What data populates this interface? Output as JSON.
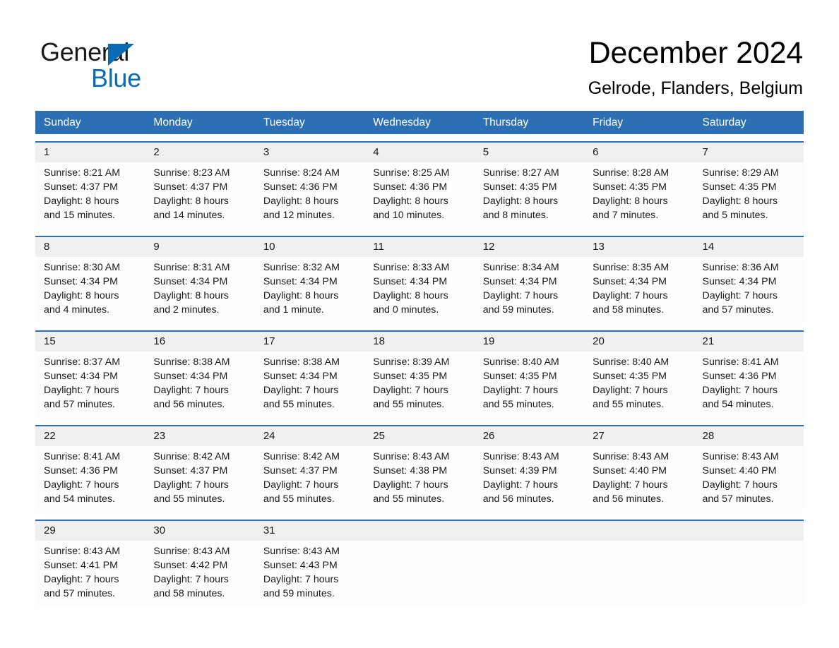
{
  "brand": {
    "name_part1": "General",
    "name_part2": "Blue",
    "logo_icon": "triangle-icon",
    "accent_color": "#0a6bb5"
  },
  "header": {
    "title": "December 2024",
    "location": "Gelrode, Flanders, Belgium"
  },
  "theme": {
    "header_blue": "#2c6fb4",
    "row_border_blue": "#2c6fb4",
    "daynum_band": "#f0f0f0",
    "cell_background": "#fdfdfd",
    "text": "#1a1a1a"
  },
  "weekdays": [
    "Sunday",
    "Monday",
    "Tuesday",
    "Wednesday",
    "Thursday",
    "Friday",
    "Saturday"
  ],
  "weeks": [
    {
      "days": [
        {
          "date": "1",
          "sunrise": "Sunrise: 8:21 AM",
          "sunset": "Sunset: 4:37 PM",
          "daylight_line1": "Daylight: 8 hours",
          "daylight_line2": "and 15 minutes."
        },
        {
          "date": "2",
          "sunrise": "Sunrise: 8:23 AM",
          "sunset": "Sunset: 4:37 PM",
          "daylight_line1": "Daylight: 8 hours",
          "daylight_line2": "and 14 minutes."
        },
        {
          "date": "3",
          "sunrise": "Sunrise: 8:24 AM",
          "sunset": "Sunset: 4:36 PM",
          "daylight_line1": "Daylight: 8 hours",
          "daylight_line2": "and 12 minutes."
        },
        {
          "date": "4",
          "sunrise": "Sunrise: 8:25 AM",
          "sunset": "Sunset: 4:36 PM",
          "daylight_line1": "Daylight: 8 hours",
          "daylight_line2": "and 10 minutes."
        },
        {
          "date": "5",
          "sunrise": "Sunrise: 8:27 AM",
          "sunset": "Sunset: 4:35 PM",
          "daylight_line1": "Daylight: 8 hours",
          "daylight_line2": "and 8 minutes."
        },
        {
          "date": "6",
          "sunrise": "Sunrise: 8:28 AM",
          "sunset": "Sunset: 4:35 PM",
          "daylight_line1": "Daylight: 8 hours",
          "daylight_line2": "and 7 minutes."
        },
        {
          "date": "7",
          "sunrise": "Sunrise: 8:29 AM",
          "sunset": "Sunset: 4:35 PM",
          "daylight_line1": "Daylight: 8 hours",
          "daylight_line2": "and 5 minutes."
        }
      ]
    },
    {
      "days": [
        {
          "date": "8",
          "sunrise": "Sunrise: 8:30 AM",
          "sunset": "Sunset: 4:34 PM",
          "daylight_line1": "Daylight: 8 hours",
          "daylight_line2": "and 4 minutes."
        },
        {
          "date": "9",
          "sunrise": "Sunrise: 8:31 AM",
          "sunset": "Sunset: 4:34 PM",
          "daylight_line1": "Daylight: 8 hours",
          "daylight_line2": "and 2 minutes."
        },
        {
          "date": "10",
          "sunrise": "Sunrise: 8:32 AM",
          "sunset": "Sunset: 4:34 PM",
          "daylight_line1": "Daylight: 8 hours",
          "daylight_line2": "and 1 minute."
        },
        {
          "date": "11",
          "sunrise": "Sunrise: 8:33 AM",
          "sunset": "Sunset: 4:34 PM",
          "daylight_line1": "Daylight: 8 hours",
          "daylight_line2": "and 0 minutes."
        },
        {
          "date": "12",
          "sunrise": "Sunrise: 8:34 AM",
          "sunset": "Sunset: 4:34 PM",
          "daylight_line1": "Daylight: 7 hours",
          "daylight_line2": "and 59 minutes."
        },
        {
          "date": "13",
          "sunrise": "Sunrise: 8:35 AM",
          "sunset": "Sunset: 4:34 PM",
          "daylight_line1": "Daylight: 7 hours",
          "daylight_line2": "and 58 minutes."
        },
        {
          "date": "14",
          "sunrise": "Sunrise: 8:36 AM",
          "sunset": "Sunset: 4:34 PM",
          "daylight_line1": "Daylight: 7 hours",
          "daylight_line2": "and 57 minutes."
        }
      ]
    },
    {
      "days": [
        {
          "date": "15",
          "sunrise": "Sunrise: 8:37 AM",
          "sunset": "Sunset: 4:34 PM",
          "daylight_line1": "Daylight: 7 hours",
          "daylight_line2": "and 57 minutes."
        },
        {
          "date": "16",
          "sunrise": "Sunrise: 8:38 AM",
          "sunset": "Sunset: 4:34 PM",
          "daylight_line1": "Daylight: 7 hours",
          "daylight_line2": "and 56 minutes."
        },
        {
          "date": "17",
          "sunrise": "Sunrise: 8:38 AM",
          "sunset": "Sunset: 4:34 PM",
          "daylight_line1": "Daylight: 7 hours",
          "daylight_line2": "and 55 minutes."
        },
        {
          "date": "18",
          "sunrise": "Sunrise: 8:39 AM",
          "sunset": "Sunset: 4:35 PM",
          "daylight_line1": "Daylight: 7 hours",
          "daylight_line2": "and 55 minutes."
        },
        {
          "date": "19",
          "sunrise": "Sunrise: 8:40 AM",
          "sunset": "Sunset: 4:35 PM",
          "daylight_line1": "Daylight: 7 hours",
          "daylight_line2": "and 55 minutes."
        },
        {
          "date": "20",
          "sunrise": "Sunrise: 8:40 AM",
          "sunset": "Sunset: 4:35 PM",
          "daylight_line1": "Daylight: 7 hours",
          "daylight_line2": "and 55 minutes."
        },
        {
          "date": "21",
          "sunrise": "Sunrise: 8:41 AM",
          "sunset": "Sunset: 4:36 PM",
          "daylight_line1": "Daylight: 7 hours",
          "daylight_line2": "and 54 minutes."
        }
      ]
    },
    {
      "days": [
        {
          "date": "22",
          "sunrise": "Sunrise: 8:41 AM",
          "sunset": "Sunset: 4:36 PM",
          "daylight_line1": "Daylight: 7 hours",
          "daylight_line2": "and 54 minutes."
        },
        {
          "date": "23",
          "sunrise": "Sunrise: 8:42 AM",
          "sunset": "Sunset: 4:37 PM",
          "daylight_line1": "Daylight: 7 hours",
          "daylight_line2": "and 55 minutes."
        },
        {
          "date": "24",
          "sunrise": "Sunrise: 8:42 AM",
          "sunset": "Sunset: 4:37 PM",
          "daylight_line1": "Daylight: 7 hours",
          "daylight_line2": "and 55 minutes."
        },
        {
          "date": "25",
          "sunrise": "Sunrise: 8:43 AM",
          "sunset": "Sunset: 4:38 PM",
          "daylight_line1": "Daylight: 7 hours",
          "daylight_line2": "and 55 minutes."
        },
        {
          "date": "26",
          "sunrise": "Sunrise: 8:43 AM",
          "sunset": "Sunset: 4:39 PM",
          "daylight_line1": "Daylight: 7 hours",
          "daylight_line2": "and 56 minutes."
        },
        {
          "date": "27",
          "sunrise": "Sunrise: 8:43 AM",
          "sunset": "Sunset: 4:40 PM",
          "daylight_line1": "Daylight: 7 hours",
          "daylight_line2": "and 56 minutes."
        },
        {
          "date": "28",
          "sunrise": "Sunrise: 8:43 AM",
          "sunset": "Sunset: 4:40 PM",
          "daylight_line1": "Daylight: 7 hours",
          "daylight_line2": "and 57 minutes."
        }
      ]
    },
    {
      "days": [
        {
          "date": "29",
          "sunrise": "Sunrise: 8:43 AM",
          "sunset": "Sunset: 4:41 PM",
          "daylight_line1": "Daylight: 7 hours",
          "daylight_line2": "and 57 minutes."
        },
        {
          "date": "30",
          "sunrise": "Sunrise: 8:43 AM",
          "sunset": "Sunset: 4:42 PM",
          "daylight_line1": "Daylight: 7 hours",
          "daylight_line2": "and 58 minutes."
        },
        {
          "date": "31",
          "sunrise": "Sunrise: 8:43 AM",
          "sunset": "Sunset: 4:43 PM",
          "daylight_line1": "Daylight: 7 hours",
          "daylight_line2": "and 59 minutes."
        },
        {
          "date": "",
          "sunrise": "",
          "sunset": "",
          "daylight_line1": "",
          "daylight_line2": ""
        },
        {
          "date": "",
          "sunrise": "",
          "sunset": "",
          "daylight_line1": "",
          "daylight_line2": ""
        },
        {
          "date": "",
          "sunrise": "",
          "sunset": "",
          "daylight_line1": "",
          "daylight_line2": ""
        },
        {
          "date": "",
          "sunrise": "",
          "sunset": "",
          "daylight_line1": "",
          "daylight_line2": ""
        }
      ]
    }
  ]
}
